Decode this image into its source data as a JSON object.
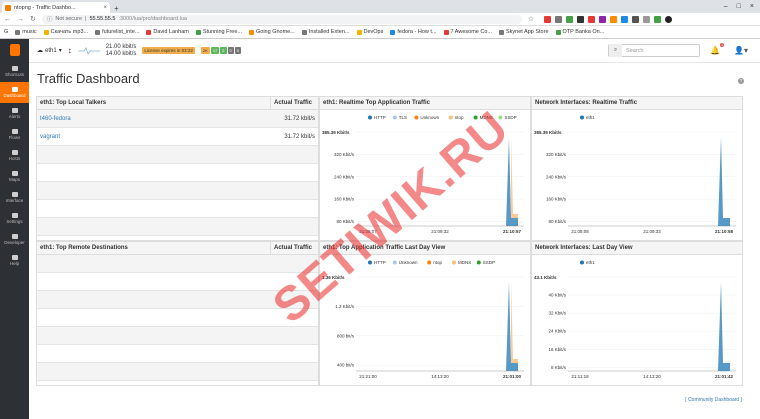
{
  "browser": {
    "tab_title": "ntopng - Traffic Dashbo...",
    "url_security": "Not secure",
    "url_host": "55.55.55.5",
    "url_path": ":3000/lua/pro/dashboard.lua",
    "bookmarks": [
      "G",
      "music",
      "Скачать mp3...",
      "futurelist_inte...",
      "David Lanham",
      "Stunning Free...",
      "Going Gnome...",
      "Installed Exten...",
      "DevOps",
      "fedora - How t...",
      "7 Awesome Co...",
      "Skynet App Store",
      "OTP Banka On..."
    ]
  },
  "sidebar": {
    "items": [
      {
        "label": "Shortcuts"
      },
      {
        "label": "Dashboard"
      },
      {
        "label": "Alerts"
      },
      {
        "label": "Flows"
      },
      {
        "label": "Hosts"
      },
      {
        "label": "Maps"
      },
      {
        "label": "Interface"
      },
      {
        "label": "Settings"
      },
      {
        "label": "Developer"
      },
      {
        "label": "Help"
      }
    ]
  },
  "topbar": {
    "interface": "eth1",
    "tput_up": "21.00 kbit/s",
    "tput_down": "14.00 kbit/s",
    "license": "License expires in 03:22",
    "badges": [
      "2K",
      "17",
      "2",
      "0",
      "0"
    ],
    "search_placeholder": "Search",
    "alerts_count": "1"
  },
  "page": {
    "title": "Traffic Dashboard",
    "footer_link": "[ Community Dashboard ]"
  },
  "panels": {
    "local_talkers": {
      "title": "eth1: Top Local Talkers",
      "col": "Actual Traffic",
      "rows": [
        {
          "name": "t460-fedora",
          "value": "31.72 kbit/s"
        },
        {
          "name": "vagrant",
          "value": "31.72 kbit/s"
        },
        {
          "name": "",
          "value": ""
        },
        {
          "name": "",
          "value": ""
        },
        {
          "name": "",
          "value": ""
        },
        {
          "name": "",
          "value": ""
        },
        {
          "name": "",
          "value": ""
        }
      ]
    },
    "remote_dest": {
      "title": "eth1: Top Remote Destinations",
      "col": "Actual Traffic",
      "rows": [
        {
          "name": "",
          "value": ""
        },
        {
          "name": "",
          "value": ""
        },
        {
          "name": "",
          "value": ""
        },
        {
          "name": "",
          "value": ""
        },
        {
          "name": "",
          "value": ""
        },
        {
          "name": "",
          "value": ""
        },
        {
          "name": "",
          "value": ""
        }
      ]
    },
    "rt_apps": {
      "title": "eth1: Realtime Top Application Traffic"
    },
    "rt_ifaces": {
      "title": "Network Interfaces: Realtime Traffic"
    },
    "day_apps": {
      "title": "eth1: Top Application Traffic Last Day View"
    },
    "day_ifaces": {
      "title": "Network Interfaces: Last Day View"
    }
  },
  "watermark": "SETIWIK.RU",
  "chart_data": [
    {
      "type": "area",
      "title": "eth1: Realtime Top Application Traffic",
      "max_label": "385.39 Kbit/s",
      "yticks": [
        "320 Kbit/s",
        "240 Kbit/s",
        "160 Kbit/s",
        "80 Kbit/s"
      ],
      "xticks": [
        "21:08:07",
        "21:09:32",
        "21:10:57"
      ],
      "series": [
        {
          "name": "HTTP",
          "color": "#1f77b4"
        },
        {
          "name": "TLS",
          "color": "#aec7e8"
        },
        {
          "name": "Unknown",
          "color": "#ff7f0e"
        },
        {
          "name": "ntop",
          "color": "#ffbb78"
        },
        {
          "name": "MDNS",
          "color": "#2ca02c"
        },
        {
          "name": "SSDP",
          "color": "#98df8a"
        }
      ]
    },
    {
      "type": "area",
      "title": "Network Interfaces: Realtime Traffic",
      "max_label": "385.39 Kbit/s",
      "yticks": [
        "320 Kbit/s",
        "240 Kbit/s",
        "160 Kbit/s",
        "80 Kbit/s"
      ],
      "xticks": [
        "21:08:08",
        "21:09:33",
        "21:10:58"
      ],
      "series": [
        {
          "name": "eth1",
          "color": "#1f77b4"
        }
      ]
    },
    {
      "type": "area",
      "title": "eth1: Top Application Traffic Last Day View",
      "max_label": "1.36 Kbit/s",
      "yticks": [
        "1.2 Kbit/s",
        "800 bit/s",
        "400 bit/s"
      ],
      "xticks": [
        "21:21:00",
        "14:13:20",
        "21:01:00"
      ],
      "series": [
        {
          "name": "HTTP",
          "color": "#1f77b4"
        },
        {
          "name": "Unknown",
          "color": "#aec7e8"
        },
        {
          "name": "ntop",
          "color": "#ff7f0e"
        },
        {
          "name": "MDNS",
          "color": "#ffbb78"
        },
        {
          "name": "SSDP",
          "color": "#2ca02c"
        }
      ]
    },
    {
      "type": "area",
      "title": "Network Interfaces: Last Day View",
      "max_label": "43.1 Kbit/s",
      "yticks": [
        "40 Kbit/s",
        "32 Kbit/s",
        "24 Kbit/s",
        "16 Kbit/s",
        "8 Kbit/s"
      ],
      "xticks": [
        "21:11:18",
        "14:13:20",
        "21:01:42"
      ],
      "series": [
        {
          "name": "eth1",
          "color": "#1f77b4"
        }
      ]
    }
  ]
}
